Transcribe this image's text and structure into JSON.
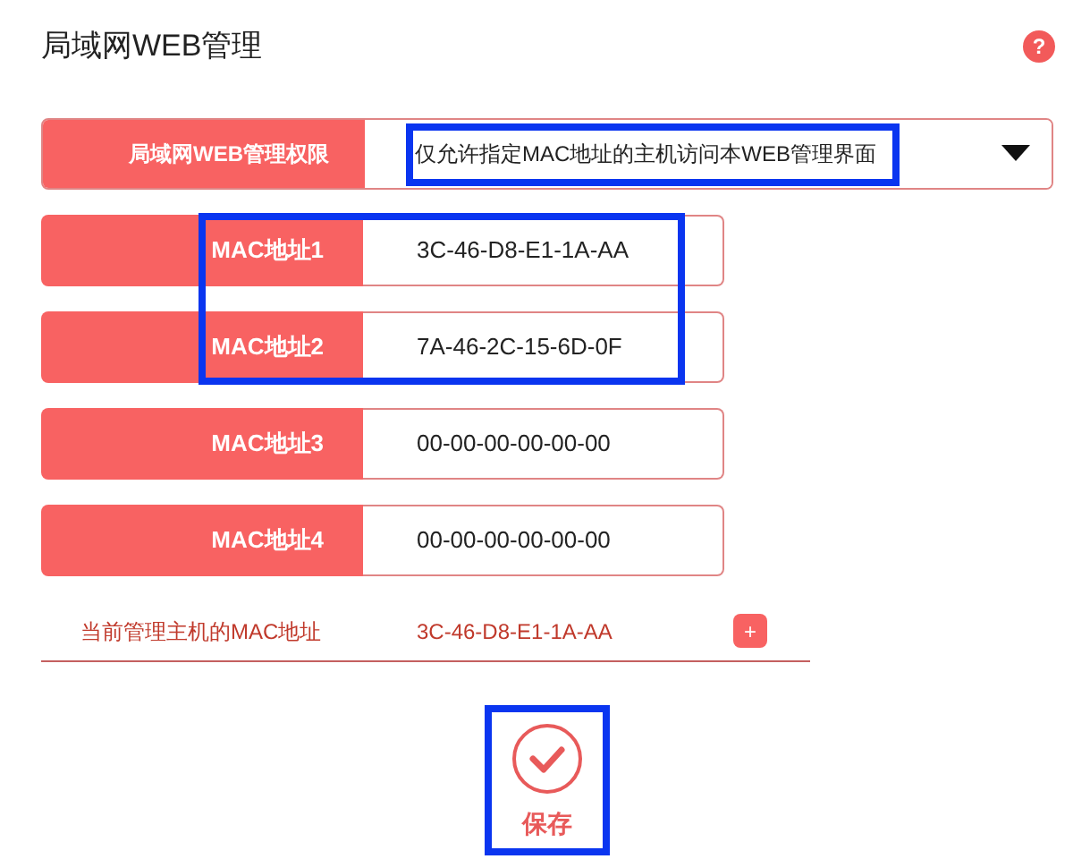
{
  "title": "局域网WEB管理",
  "help_button": "?",
  "permission": {
    "label": "局域网WEB管理权限",
    "value": "仅允许指定MAC地址的主机访问本WEB管理界面",
    "highlighted": true
  },
  "mac_addresses": [
    {
      "label": "MAC地址1",
      "value": "3C-46-D8-E1-1A-AA",
      "highlighted": true
    },
    {
      "label": "MAC地址2",
      "value": "7A-46-2C-15-6D-0F",
      "highlighted": true
    },
    {
      "label": "MAC地址3",
      "value": "00-00-00-00-00-00",
      "highlighted": false
    },
    {
      "label": "MAC地址4",
      "value": "00-00-00-00-00-00",
      "highlighted": false
    }
  ],
  "current_host": {
    "label": "当前管理主机的MAC地址",
    "value": "3C-46-D8-E1-1A-AA",
    "add_button": "+"
  },
  "save_button": {
    "label": "保存",
    "highlighted": true
  }
}
